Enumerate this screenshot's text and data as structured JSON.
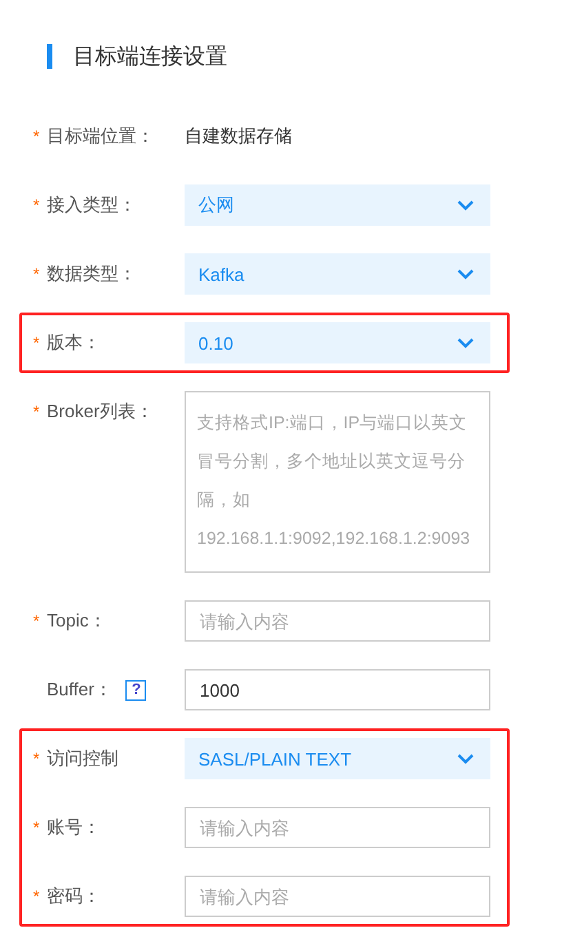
{
  "section_title": "目标端连接设置",
  "groups": [
    {
      "highlighted": false,
      "fields": [
        {
          "kind": "text",
          "required_mark": "*",
          "label": "目标端位置：",
          "value": "自建数据存储"
        },
        {
          "kind": "select",
          "required_mark": "*",
          "label": "接入类型：",
          "value": "公网"
        },
        {
          "kind": "select",
          "required_mark": "*",
          "label": "数据类型：",
          "value": "Kafka"
        }
      ]
    },
    {
      "highlighted": true,
      "fields": [
        {
          "kind": "select",
          "required_mark": "*",
          "label": "版本：",
          "value": "0.10"
        }
      ]
    },
    {
      "highlighted": false,
      "fields": [
        {
          "kind": "textarea",
          "required_mark": "*",
          "label": "Broker列表：",
          "placeholder": "支持格式IP:端口，IP与端口以英文冒号分割，多个地址以英文逗号分隔，如192.168.1.1:9092,192.168.1.2:9093"
        },
        {
          "kind": "input",
          "required_mark": "*",
          "label": "Topic：",
          "placeholder": "请输入内容"
        },
        {
          "kind": "input",
          "label": "Buffer：",
          "help_glyph": "?",
          "value": "1000"
        }
      ]
    },
    {
      "highlighted": true,
      "fields": [
        {
          "kind": "select",
          "required_mark": "*",
          "label": "访问控制",
          "value": "SASL/PLAIN TEXT"
        },
        {
          "kind": "input",
          "required_mark": "*",
          "label": "账号：",
          "placeholder": "请输入内容"
        },
        {
          "kind": "input",
          "required_mark": "*",
          "label": "密码：",
          "placeholder": "请输入内容"
        }
      ]
    }
  ]
}
